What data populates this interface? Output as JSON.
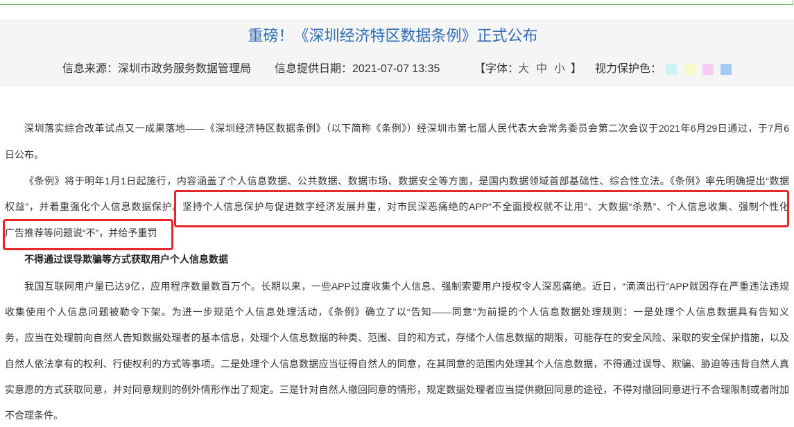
{
  "header": {
    "title": "重磅！《深圳经济特区数据条例》正式公布",
    "source_label": "信息来源：",
    "source_value": "深圳市政务服务数据管理局",
    "date_label": "信息提供日期：",
    "date_value": "2021-07-07 13:35",
    "font_size_label": "【字体：",
    "font_size_options": [
      "大",
      "中",
      "小"
    ],
    "font_size_close": "】",
    "eye_protection_label": "视力保护色：",
    "eye_protection_colors": [
      "#cdf3f8",
      "#faf7c8",
      "#f7ccf4",
      "#a5caf1"
    ]
  },
  "article": {
    "paragraph_1": [
      "深圳落实综合改革试点又一成果落地——《深圳经济特区数据条例》（以下简称《条例》）经深圳市第七届人民代表大会常务委员会第二次会议于2021年6月29日通过，于7月6",
      "日公布。"
    ],
    "paragraph_2": {
      "line_1": "《条例》将于明年1月1日起施行，内容涵盖了个人信息数据、公共数据、数据市场、数据安全等方面，是国内数据领域首部基础性、综合性立法。《条例》率先明确提出“数据",
      "line_2_plain": "权益”，并着重强化个人信息数据保护。",
      "line_2_highlighted": "坚持个人信息保护与促进数字经济发展并重，对市民深恶痛绝的APP“不全面授权就不让用”、大数据“杀熟”、个人信息收集、强制个性化",
      "line_3_highlighted": "广告推荐等问题说“不”，并给予重罚"
    },
    "subheading": "不得通过误导欺骗等方式获取用户个人信息数据",
    "paragraph_3": [
      "我国互联网用户量已达9亿，应用程序数量数百万个。长期以来，一些APP过度收集个人信息、强制索要用户授权令人深恶痛绝。近日，“滴滴出行”APP就因存在严重违法违规",
      "收集使用个人信息问题被勒令下架。为进一步规范个人信息处理活动，《条例》确立了以“告知——同意”为前提的个人信息数据处理规则：一是处理个人信息数据具有告知义",
      "务，应当在处理前向自然人告知数据处理者的基本信息，处理个人信息数据的种类、范围、目的和方式，存储个人信息数据的期限，可能存在的安全风险、采取的安全保护措施，以及",
      "自然人依法享有的权利、行使权利的方式等事项。二是处理个人信息数据应当征得自然人的同意，在其同意的范围内处理其个人信息数据，不得通过误导、欺骗、胁迫等违背自然人真",
      "实意愿的方式获取同意，并对同意规则的例外情形作出了规定。三是针对自然人撤回同意的情形，规定数据处理者应当提供撤回同意的途径，不得对撤回同意进行不合理限制或者附加",
      "不合理条件。"
    ]
  },
  "colors": {
    "title": "#2f6db5",
    "annotation_box": "#e8262b",
    "header_background": "#f5f5f5",
    "top_line": "#6cbf5c",
    "body_text": "#333333"
  }
}
